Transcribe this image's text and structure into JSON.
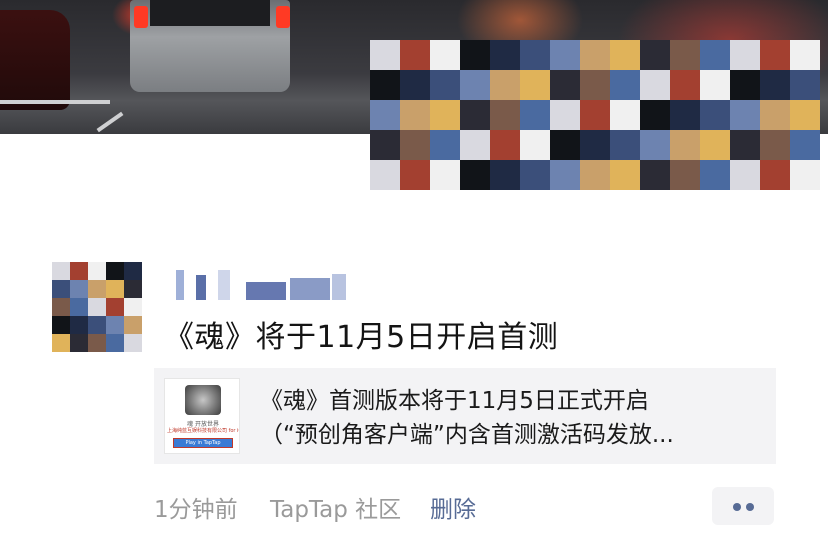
{
  "post": {
    "text": "《魂》将于11月5日开启首测",
    "share_card": {
      "title_line1": "《魂》首测版本将于11月5日正式开启",
      "title_line2": "（“预创角客户端”内含首测激活码发放...",
      "thumb_line1": "魂 开放世界",
      "thumb_line2": "上海纯蓝互娱科技有限公司 for iOS",
      "thumb_button": "Play in TapTap"
    },
    "meta": {
      "time": "1分钟前",
      "source": "TapTap 社区",
      "delete_label": "删除"
    }
  },
  "colors": {
    "link_blue": "#576b95",
    "meta_gray": "#9a9a9a",
    "card_bg": "#f3f3f5"
  },
  "icons": {
    "more": "more-dots-icon"
  }
}
